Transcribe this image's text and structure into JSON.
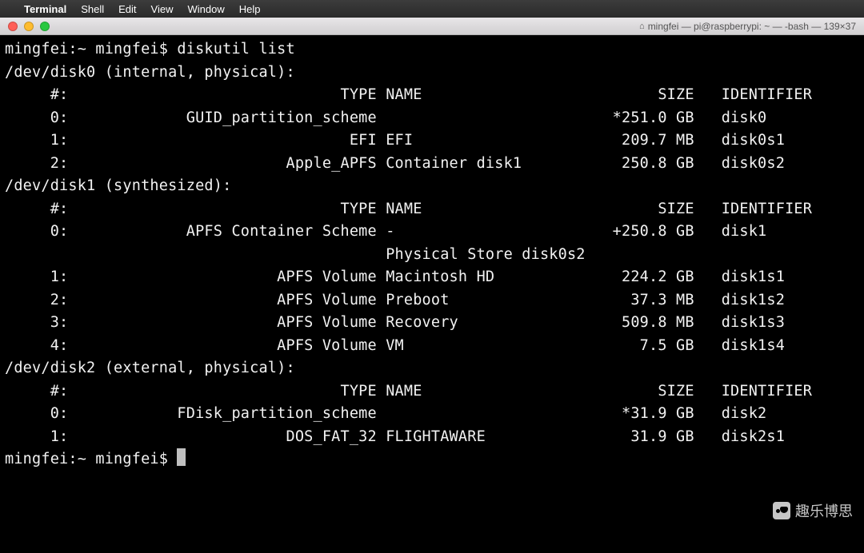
{
  "menubar": {
    "apple": "",
    "app": "Terminal",
    "items": [
      "Shell",
      "Edit",
      "View",
      "Window",
      "Help"
    ]
  },
  "window": {
    "home_icon": "⌂",
    "title": "mingfei — pi@raspberrypi: ~ — -bash — 139×37"
  },
  "prompt1": {
    "host": "mingfei",
    "path": "~",
    "user": "mingfei",
    "sep": ":",
    "dollar": "$",
    "command": "diskutil list"
  },
  "header_cols": {
    "num": "#:",
    "type": "TYPE",
    "name": "NAME",
    "size": "SIZE",
    "identifier": "IDENTIFIER"
  },
  "disks": [
    {
      "device": "/dev/disk0",
      "qualifier": "(internal, physical):",
      "rows": [
        {
          "num": "0:",
          "type": "GUID_partition_scheme",
          "name": "",
          "size": "*251.0 GB",
          "identifier": "disk0"
        },
        {
          "num": "1:",
          "type": "EFI",
          "name": "EFI",
          "size": "209.7 MB",
          "identifier": "disk0s1"
        },
        {
          "num": "2:",
          "type": "Apple_APFS",
          "name": "Container disk1",
          "size": "250.8 GB",
          "identifier": "disk0s2"
        }
      ]
    },
    {
      "device": "/dev/disk1",
      "qualifier": "(synthesized):",
      "rows": [
        {
          "num": "0:",
          "type": "APFS Container Scheme",
          "name": "-",
          "size": "+250.8 GB",
          "identifier": "disk1"
        },
        {
          "num": "",
          "type": "",
          "name": "Physical Store disk0s2",
          "size": "",
          "identifier": ""
        },
        {
          "num": "1:",
          "type": "APFS Volume",
          "name": "Macintosh HD",
          "size": "224.2 GB",
          "identifier": "disk1s1"
        },
        {
          "num": "2:",
          "type": "APFS Volume",
          "name": "Preboot",
          "size": "37.3 MB",
          "identifier": "disk1s2"
        },
        {
          "num": "3:",
          "type": "APFS Volume",
          "name": "Recovery",
          "size": "509.8 MB",
          "identifier": "disk1s3"
        },
        {
          "num": "4:",
          "type": "APFS Volume",
          "name": "VM",
          "size": "7.5 GB",
          "identifier": "disk1s4"
        }
      ]
    },
    {
      "device": "/dev/disk2",
      "qualifier": "(external, physical):",
      "rows": [
        {
          "num": "0:",
          "type": "FDisk_partition_scheme",
          "name": "",
          "size": "*31.9 GB",
          "identifier": "disk2"
        },
        {
          "num": "1:",
          "type": "DOS_FAT_32",
          "name": "FLIGHTAWARE",
          "size": "31.9 GB",
          "identifier": "disk2s1"
        }
      ]
    }
  ],
  "prompt2": {
    "host": "mingfei",
    "path": "~",
    "user": "mingfei",
    "sep": ":",
    "dollar": "$"
  },
  "watermark": {
    "text": "趣乐博思"
  }
}
